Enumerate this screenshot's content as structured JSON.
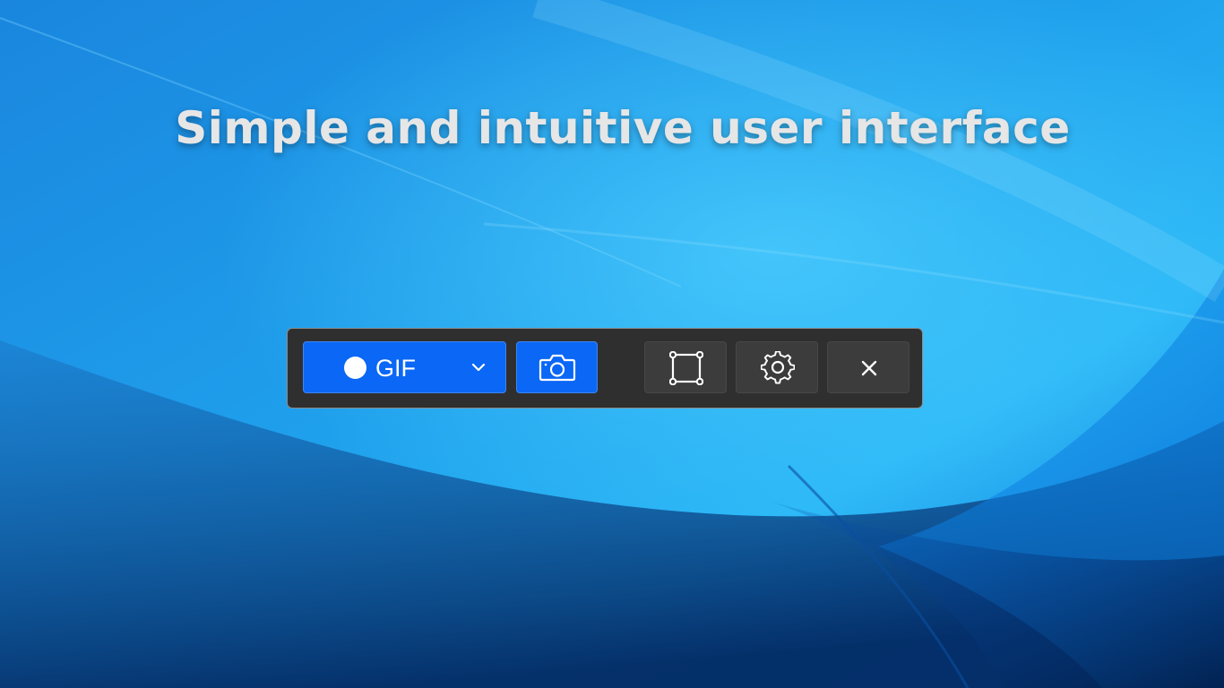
{
  "headline": "Simple and intuitive user interface",
  "toolbar": {
    "record_button": {
      "label": "GIF",
      "icon": "record-dot-icon",
      "dropdown_icon": "chevron-down-icon"
    },
    "screenshot_button": {
      "icon": "camera-icon"
    },
    "region_button": {
      "icon": "select-region-icon"
    },
    "settings_button": {
      "icon": "gear-icon"
    },
    "close_button": {
      "icon": "close-icon"
    }
  },
  "colors": {
    "accent": "#0b67f5",
    "toolbar_bg": "#2f2f2f",
    "dark_button_bg": "#3c3c3c",
    "headline_text": "#e6e6e6"
  }
}
